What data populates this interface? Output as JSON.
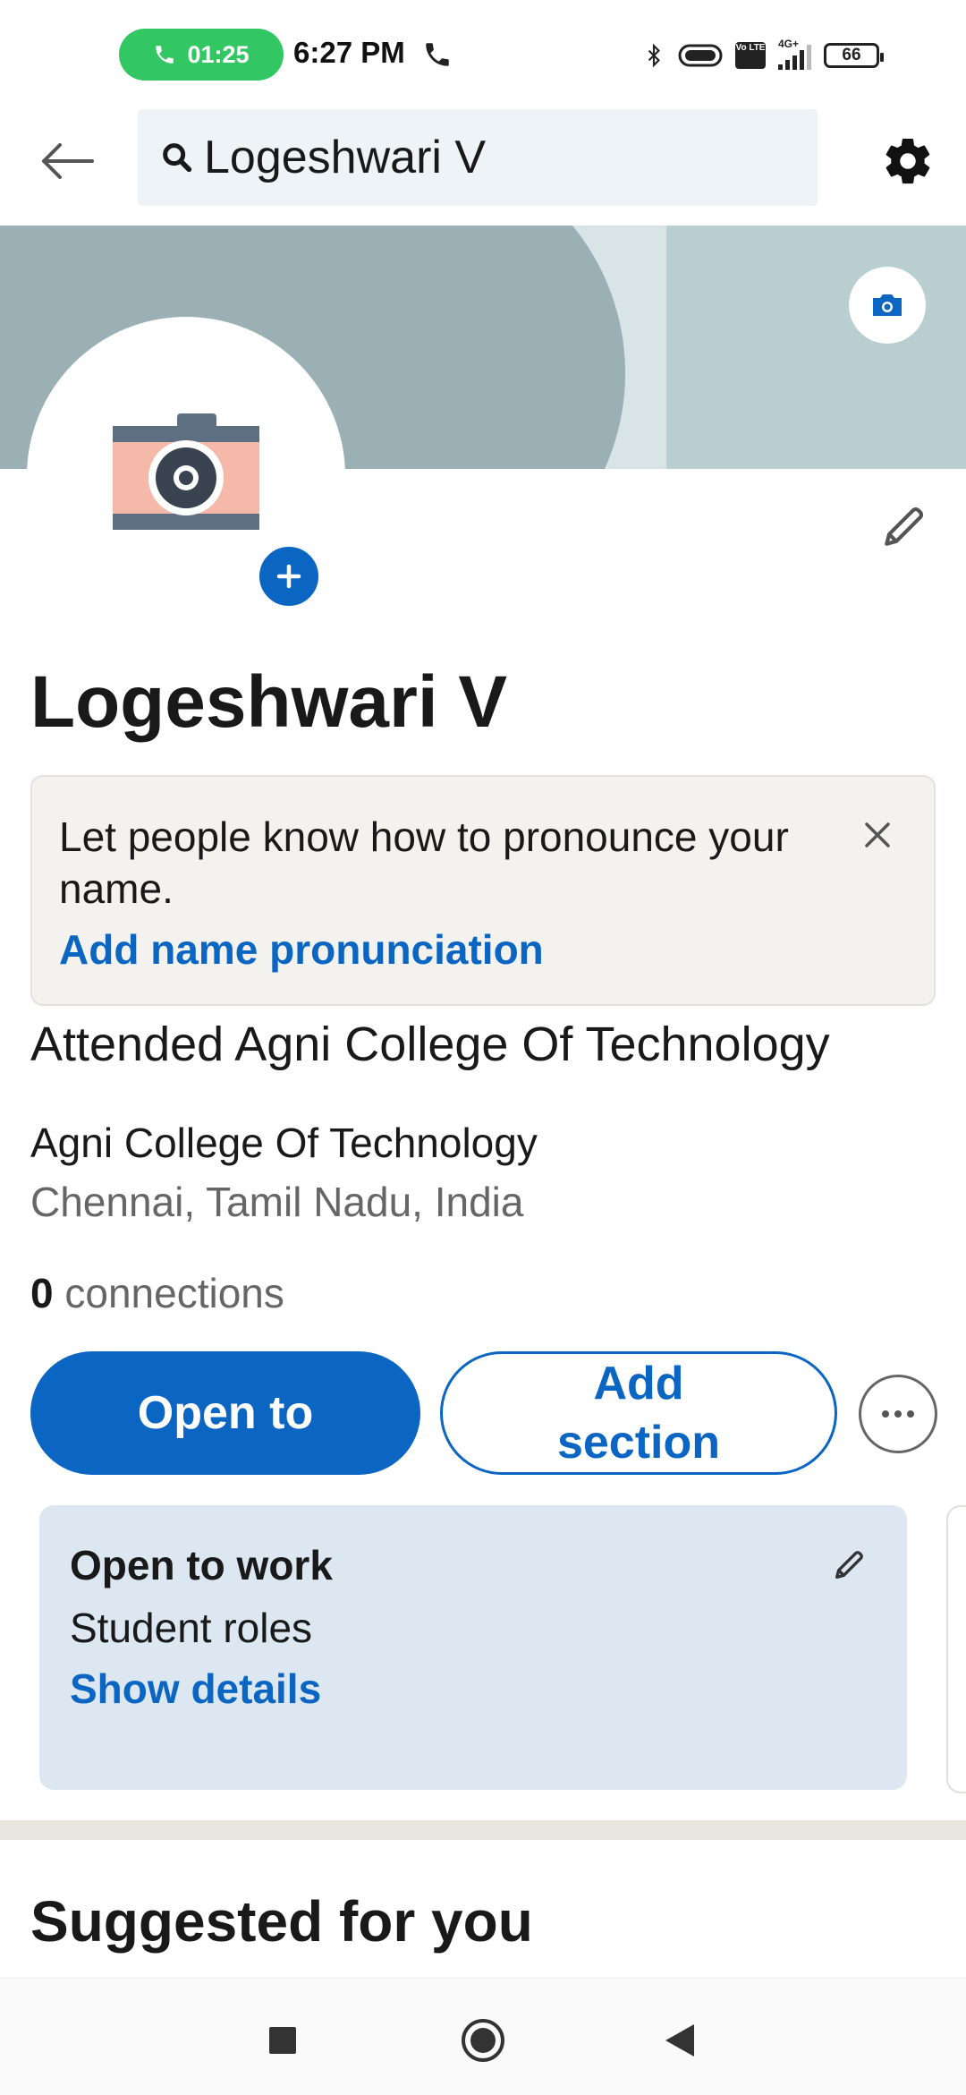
{
  "status_bar": {
    "call_timer": "01:25",
    "time": "6:27 PM",
    "network": "4G+",
    "volte": "Vo LTE",
    "battery": "66"
  },
  "header": {
    "search_value": "Logeshwari V"
  },
  "profile": {
    "name": "Logeshwari V",
    "pronunciation_prompt": "Let people know how to pronounce your name.",
    "pronunciation_link": "Add name pronunciation",
    "headline": "Attended Agni College Of Technology",
    "school": "Agni College Of Technology",
    "location": "Chennai, Tamil Nadu, India",
    "connections_count": "0",
    "connections_label": " connections"
  },
  "actions": {
    "open_to": "Open to",
    "add_section": "Add section"
  },
  "open_to_work": {
    "title": "Open to work",
    "roles": "Student roles",
    "link": "Show details"
  },
  "sections": {
    "suggested_title": "Suggested for you"
  },
  "colors": {
    "brand_blue": "#0a66c2",
    "call_green": "#33c764",
    "banner": "#9ab0b4",
    "card_bg": "#dde7f1"
  }
}
